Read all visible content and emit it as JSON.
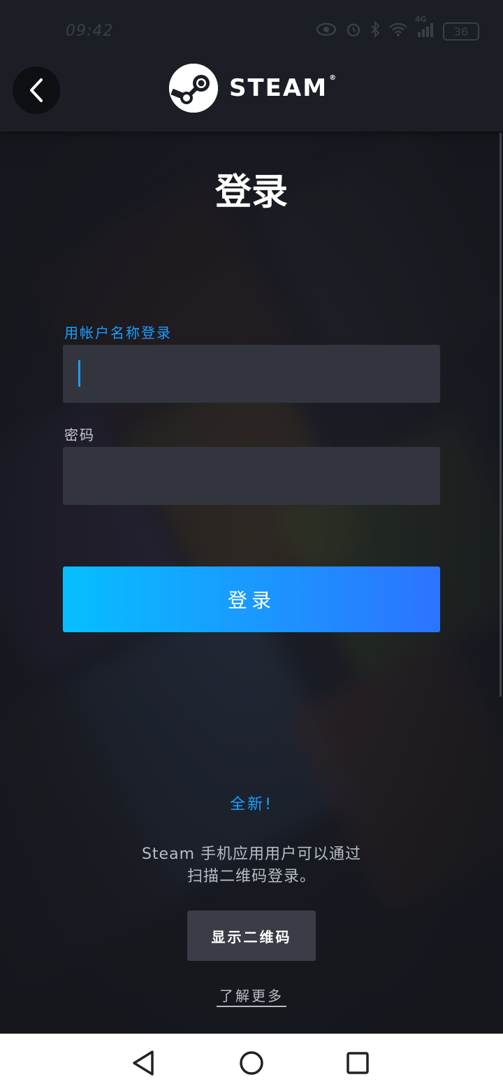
{
  "status_bar": {
    "time": "09:42",
    "network": "4G",
    "battery": "36"
  },
  "header": {
    "logo_text": "STEAM",
    "logo_reg": "®"
  },
  "login": {
    "title": "登录",
    "username_label": "用帐户名称登录",
    "username_value": "",
    "password_label": "密码",
    "password_value": "",
    "submit_label": "登录"
  },
  "qr": {
    "new_tag": "全新!",
    "description_line1": "Steam 手机应用用户可以通过",
    "description_line2": "扫描二维码登录。",
    "show_qr_label": "显示二维码",
    "learn_more_label": "了解更多"
  },
  "colors": {
    "accent": "#1a9fff",
    "button_gradient_start": "#06bfff",
    "button_gradient_end": "#2d73ff",
    "input_bg": "#32353e",
    "header_bg": "#1b1e25"
  }
}
